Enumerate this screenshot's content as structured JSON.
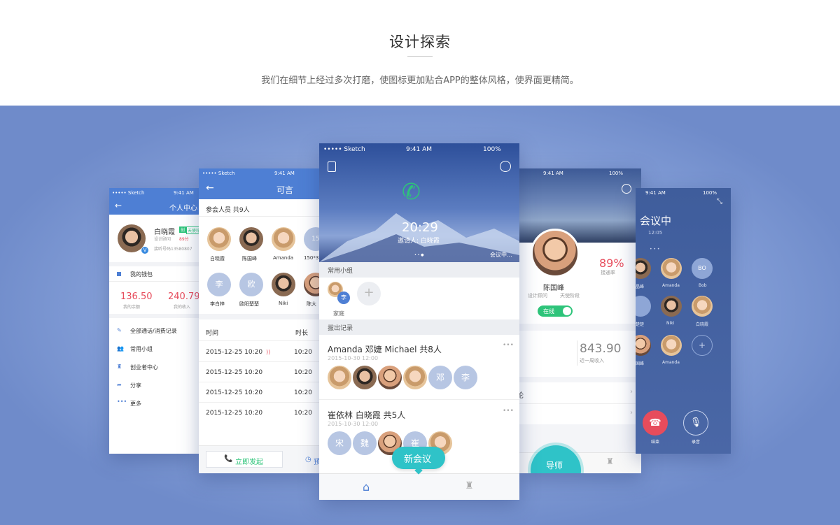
{
  "header": {
    "title": "设计探索",
    "subtitle": "我们在细节上经过多次打磨，使图标更加贴合APP的整体风格，使界面更精简。"
  },
  "p1": {
    "carrier": "••••• Sketch",
    "time": "9:41 AM",
    "title": "个人中心",
    "name": "白晓霞",
    "badge1": "创",
    "badge2": "天使轮",
    "role": "设计顾问",
    "score": "89分",
    "phone": "接听号码13580807",
    "wallet": "我的钱包",
    "balance": "136.50",
    "balance_label": "我的余额",
    "income": "240.79",
    "income_label": "我的收入",
    "menu": [
      "全部通话/消费记录",
      "常用小组",
      "创业者中心",
      "分享",
      "更多"
    ]
  },
  "p2": {
    "carrier": "••••• Sketch",
    "time": "9:41 AM",
    "title": "可言",
    "participants": "参会人员 共9人",
    "people": [
      {
        "n": "白晓霞"
      },
      {
        "n": "陈国峰"
      },
      {
        "n": "Amanda"
      },
      {
        "n": "150*3"
      },
      {
        "n": "李白梓",
        "l": "李"
      },
      {
        "n": "欧阳楚楚",
        "l": "欧"
      },
      {
        "n": "Niki"
      },
      {
        "n": "陈大"
      }
    ],
    "col_time": "时间",
    "col_dur": "时长",
    "records": [
      {
        "d": "2015-12-25 10:20",
        "v": "10:20"
      },
      {
        "d": "2015-12-25 10:20",
        "v": "10:20"
      },
      {
        "d": "2015-12-25 10:20",
        "v": "10:20"
      },
      {
        "d": "2015-12-25 10:20",
        "v": "10:20"
      }
    ],
    "start": "立即发起",
    "more": "预"
  },
  "p3": {
    "carrier": "••••• Sketch",
    "time": "9:41 AM",
    "battery": "100%",
    "clock": "20:29",
    "inviter": "邀请人: 白晓霞",
    "meeting": "会议中...",
    "groups_title": "常用小组",
    "group_name": "家庭",
    "group_letter": "李",
    "calls_title": "拔出记录",
    "calls": [
      {
        "title": "Amanda 邓婕 Michael 共8人",
        "date": "2015-10-30 12:00",
        "letters": [
          "邓",
          "李"
        ]
      },
      {
        "title": "崔依林 白晓霞 共5人",
        "date": "2015-10-30 12:00",
        "letters": [
          "宋",
          "魏",
          "崔"
        ]
      }
    ],
    "new": "新会议"
  },
  "p4": {
    "time": "9:41 AM",
    "battery": "100%",
    "pct": "89%",
    "pct_label": "接通率",
    "name": "陈国峰",
    "role": "设计顾问",
    "stage": "天使阶段",
    "online": "在线",
    "income": "843.90",
    "income_label": "近一周收入",
    "item1": "论",
    "mentor": "导师"
  },
  "p5": {
    "time": "9:41 AM",
    "battery": "100%",
    "title": "会议中",
    "clock": "12:05",
    "people": [
      {
        "n": "晶峰"
      },
      {
        "n": "Amanda"
      },
      {
        "n": "Bob",
        "l": "BO"
      },
      {
        "n": "楚楚"
      },
      {
        "n": "Niki"
      },
      {
        "n": "白晓霞"
      },
      {
        "n": "国峰"
      },
      {
        "n": "Amanda"
      }
    ],
    "end": "结束",
    "record": "录音"
  },
  "colors": {
    "blue": "#4e7fd4",
    "green": "#2ec47a",
    "teal": "#2fc3c8",
    "red": "#e74c5c"
  }
}
